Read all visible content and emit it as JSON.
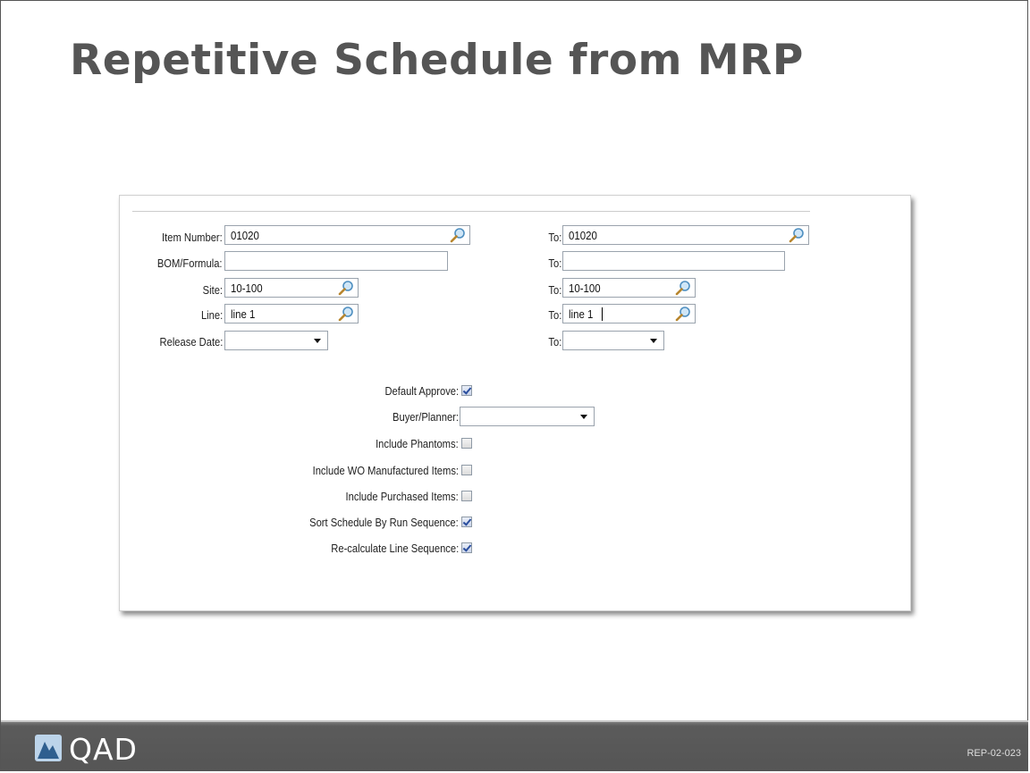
{
  "slide": {
    "title": "Repetitive Schedule from MRP",
    "code": "REP-02-023"
  },
  "logo": {
    "text": "QAD"
  },
  "form": {
    "item_number": {
      "label": "Item Number:",
      "from": "01020",
      "to_label": "To:",
      "to": "01020"
    },
    "bom_formula": {
      "label": "BOM/Formula:",
      "from": "",
      "to_label": "To:",
      "to": ""
    },
    "site": {
      "label": "Site:",
      "from": "10-100",
      "to_label": "To:",
      "to": "10-100"
    },
    "line": {
      "label": "Line:",
      "from": "line 1",
      "to_label": "To:",
      "to": "line 1"
    },
    "release_date": {
      "label": "Release Date:",
      "from": "",
      "to_label": "To:",
      "to": ""
    },
    "default_approve": {
      "label": "Default Approve:",
      "checked": true
    },
    "buyer_planner": {
      "label": "Buyer/Planner:",
      "value": ""
    },
    "include_phantoms": {
      "label": "Include Phantoms:",
      "checked": false
    },
    "include_wo": {
      "label": "Include WO Manufactured Items:",
      "checked": false
    },
    "include_purchased": {
      "label": "Include Purchased Items:",
      "checked": false
    },
    "sort_by_run": {
      "label": "Sort Schedule By Run Sequence:",
      "checked": true
    },
    "recalc_line_seq": {
      "label": "Re-calculate Line Sequence:",
      "checked": true
    }
  },
  "icons": {
    "lookup": "magnifier-icon",
    "dropdown": "chevron-down-icon",
    "brand": "qad-logo-icon"
  },
  "colors": {
    "title": "#555555",
    "footer": "#555555",
    "checkmark": "#2a4e9e"
  }
}
